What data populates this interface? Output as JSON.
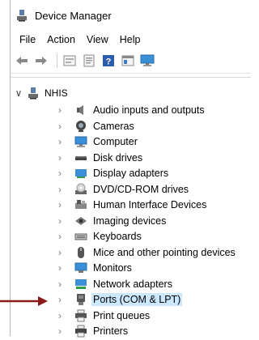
{
  "window": {
    "title": "Device Manager"
  },
  "menu": [
    "File",
    "Action",
    "View",
    "Help"
  ],
  "toolbar": [
    {
      "icon": "back-arrow-icon"
    },
    {
      "icon": "forward-arrow-icon"
    },
    {
      "icon": "properties-icon"
    },
    {
      "icon": "update-driver-icon"
    },
    {
      "icon": "help-icon"
    },
    {
      "icon": "view-icon"
    },
    {
      "icon": "monitor-scan-icon"
    }
  ],
  "tree": {
    "root": "NHIS",
    "items": [
      {
        "label": "Audio inputs and outputs",
        "icon": "speaker-icon"
      },
      {
        "label": "Cameras",
        "icon": "camera-icon"
      },
      {
        "label": "Computer",
        "icon": "computer-icon"
      },
      {
        "label": "Disk drives",
        "icon": "disk-drive-icon"
      },
      {
        "label": "Display adapters",
        "icon": "display-adapter-icon"
      },
      {
        "label": "DVD/CD-ROM drives",
        "icon": "dvd-icon"
      },
      {
        "label": "Human Interface Devices",
        "icon": "hid-icon"
      },
      {
        "label": "Imaging devices",
        "icon": "imaging-icon"
      },
      {
        "label": "Keyboards",
        "icon": "keyboard-icon"
      },
      {
        "label": "Mice and other pointing devices",
        "icon": "mouse-icon"
      },
      {
        "label": "Monitors",
        "icon": "monitor-icon"
      },
      {
        "label": "Network adapters",
        "icon": "network-icon"
      },
      {
        "label": "Ports (COM & LPT)",
        "icon": "port-icon",
        "selected": true
      },
      {
        "label": "Print queues",
        "icon": "print-queue-icon"
      },
      {
        "label": "Printers",
        "icon": "printer-icon"
      }
    ]
  },
  "colors": {
    "accent_arrow": "#8b1a1a",
    "selection": "#cce8ff"
  }
}
